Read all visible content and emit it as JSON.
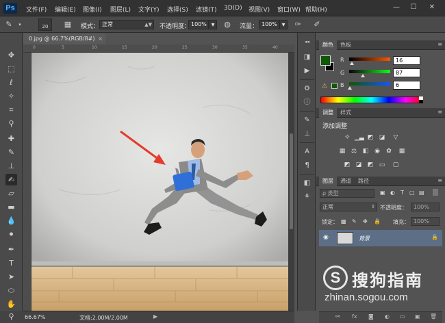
{
  "app": {
    "logo": "Ps",
    "menus": [
      "文件(F)",
      "编辑(E)",
      "图像(I)",
      "图层(L)",
      "文字(Y)",
      "选择(S)",
      "滤镜(T)",
      "3D(D)",
      "视图(V)",
      "窗口(W)",
      "帮助(H)"
    ],
    "window_controls": [
      "—",
      "☐",
      "✕"
    ]
  },
  "options": {
    "brush_size": "20",
    "mode_label": "模式：",
    "mode_value": "正常",
    "opacity_label": "不透明度：",
    "opacity_value": "100%",
    "flow_label": "流量：",
    "flow_value": "100%"
  },
  "document": {
    "tab_title": "0.jpg @ 66.7%(RGB/8#)",
    "tab_close": "×",
    "ruler_ticks": [
      "0",
      "5",
      "10",
      "15",
      "20",
      "25",
      "30",
      "35",
      "40"
    ],
    "zoom": "66.67%",
    "doc_info": "文档:2.00M/2.00M",
    "status_arrow": "▶"
  },
  "color_panel": {
    "tabs": [
      "颜色",
      "色板"
    ],
    "channels": [
      {
        "label": "R",
        "value": "16",
        "knob": 0.06,
        "grad_from": "#000000",
        "grad_to": "#ff5700"
      },
      {
        "label": "G",
        "value": "87",
        "knob": 0.34,
        "grad_from": "#100010",
        "grad_to": "#10ff10"
      },
      {
        "label": "B",
        "value": "6",
        "knob": 0.02,
        "grad_from": "#105700",
        "grad_to": "#1057ff"
      }
    ],
    "fg_color": "#105706",
    "bg_color": "#000000"
  },
  "adjustments_panel": {
    "tabs": [
      "调整",
      "样式"
    ],
    "heading": "添加调整"
  },
  "layers_panel": {
    "tabs": [
      "图层",
      "通道",
      "路径"
    ],
    "filter_label": "ρ 类型",
    "blend_mode": "正常",
    "opacity_label": "不透明度：",
    "opacity_value": "100%",
    "lock_label": "锁定：",
    "fill_label": "填充：",
    "fill_value": "100%",
    "layer_name": "背景"
  },
  "watermark": {
    "logo_letter": "S",
    "brand": "搜狗指南",
    "url": "zhinan.sogou.com"
  }
}
